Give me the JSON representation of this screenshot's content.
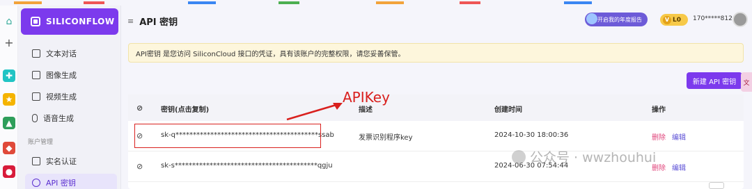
{
  "header": {
    "title": "API 密钥",
    "report_button": "开启我的年度报告",
    "level_badge": "L0",
    "user": "170*****812"
  },
  "sidebar": {
    "logo": "SILICONFLOW",
    "items": [
      {
        "label": "文本对话",
        "icon": "chat-icon"
      },
      {
        "label": "图像生成",
        "icon": "image-icon"
      },
      {
        "label": "视频生成",
        "icon": "video-icon"
      },
      {
        "label": "语音生成",
        "icon": "mic-icon"
      }
    ],
    "section_account": "账户管理",
    "account_items": [
      {
        "label": "实名认证",
        "icon": "id-card-icon"
      },
      {
        "label": "API 密钥",
        "icon": "key-icon"
      }
    ]
  },
  "notice": "API密钥 是您访问 SiliconCloud 接口的凭证，具有该账户的完整权限，请您妥善保管。",
  "new_key_button": "新建 API 密钥",
  "table": {
    "headers": [
      "密钥(点击复制)",
      "描述",
      "创建时间",
      "操作"
    ],
    "rows": [
      {
        "key": "sk-q*****************************************ssab",
        "desc": "发票识别程序key",
        "created": "2024-10-30 18:00:36",
        "delete": "删除",
        "edit": "编辑"
      },
      {
        "key": "sk-s*****************************************qgju",
        "desc": "",
        "created": "2024-06-30 07:54:44",
        "delete": "删除",
        "edit": "编辑"
      }
    ]
  },
  "annotation": "APIKey",
  "watermark": "公众号 · wwzhouhui",
  "colors": {
    "brand": "#7c3aed",
    "annotation": "#d9201e",
    "delete": "#e0457b"
  }
}
